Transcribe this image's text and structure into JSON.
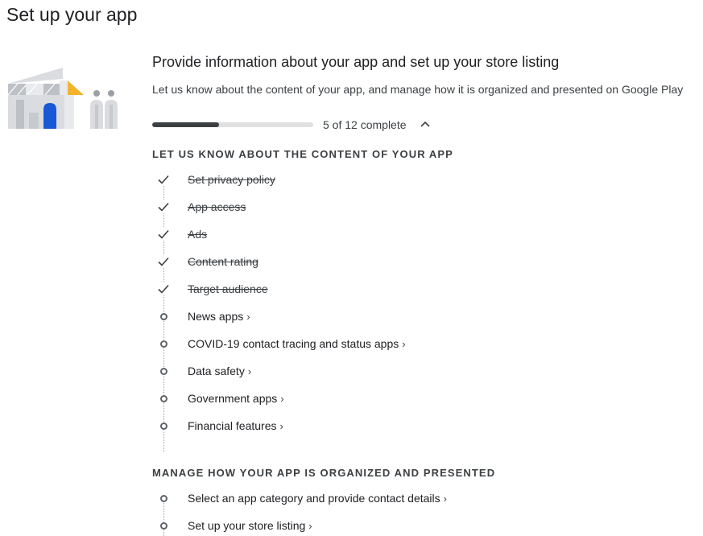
{
  "page": {
    "title": "Set up your app"
  },
  "setup": {
    "headline": "Provide information about your app and set up your store listing",
    "description": "Let us know about the content of your app, and manage how it is organized and presented on Google Play",
    "progress": {
      "completed": 5,
      "total": 12,
      "fraction": 0.4167,
      "label": "5 of 12 complete",
      "expanded": true
    }
  },
  "sections": [
    {
      "heading": "LET US KNOW ABOUT THE CONTENT OF YOUR APP",
      "tasks": [
        {
          "label": "Set privacy policy",
          "done": true
        },
        {
          "label": "App access",
          "done": true
        },
        {
          "label": "Ads",
          "done": true
        },
        {
          "label": "Content rating",
          "done": true
        },
        {
          "label": "Target audience",
          "done": true
        },
        {
          "label": "News apps",
          "done": false
        },
        {
          "label": "COVID-19 contact tracing and status apps",
          "done": false
        },
        {
          "label": "Data safety",
          "done": false
        },
        {
          "label": "Government apps",
          "done": false
        },
        {
          "label": "Financial features",
          "done": false
        }
      ]
    },
    {
      "heading": "MANAGE HOW YOUR APP IS ORGANIZED AND PRESENTED",
      "tasks": [
        {
          "label": "Select an app category and provide contact details",
          "done": false
        },
        {
          "label": "Set up your store listing",
          "done": false
        }
      ]
    }
  ],
  "icons": {
    "done": "check-icon",
    "pending": "circle-icon",
    "link": "chevron-right-icon",
    "collapse": "chevron-up-icon"
  },
  "colors": {
    "progress_fill": "#3c4043",
    "progress_track": "#e0e0e0",
    "illustration_blue": "#1a57d6",
    "illustration_yellow": "#f2b42c"
  }
}
